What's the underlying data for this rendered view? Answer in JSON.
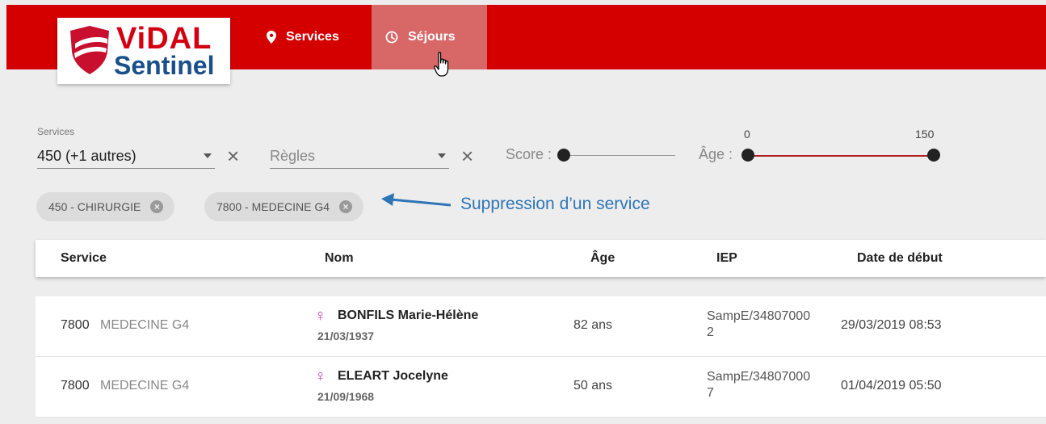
{
  "logo": {
    "brand_top": "ViDAL",
    "brand_bottom": "Sentinel"
  },
  "nav": {
    "items": [
      {
        "label": "Services",
        "icon": "map-pin-icon"
      },
      {
        "label": "Séjours",
        "icon": "clock-icon",
        "active": true
      }
    ]
  },
  "filters": {
    "services_label": "Services",
    "services_value": "450 (+1 autres)",
    "regles_placeholder": "Règles",
    "score_label": "Score :",
    "age_label": "Âge :",
    "age_min": "0",
    "age_max": "150"
  },
  "chips": [
    {
      "label": "450 - CHIRURGIE"
    },
    {
      "label": "7800 - MEDECINE G4"
    }
  ],
  "annotation": "Suppression d’un service",
  "table": {
    "headers": [
      "Service",
      "Nom",
      "Âge",
      "IEP",
      "Date de début"
    ],
    "rows": [
      {
        "service_code": "7800",
        "service_name": "MEDECINE G4",
        "name": "BONFILS Marie-Hélène",
        "dob": "21/03/1937",
        "age": "82 ans",
        "iep_line1": "SampE/34807000",
        "iep_line2": "2",
        "date": "29/03/2019 08:53"
      },
      {
        "service_code": "7800",
        "service_name": "MEDECINE G4",
        "name": "ELEART Jocelyne",
        "dob": "21/09/1968",
        "age": "50 ans",
        "iep_line1": "SampE/34807000",
        "iep_line2": "7",
        "date": "01/04/2019 05:50"
      }
    ]
  },
  "colors": {
    "brand_red": "#d40000",
    "active_tab": "#d86767",
    "annotation_blue": "#2e75b6",
    "female_icon": "#d63ab8"
  }
}
